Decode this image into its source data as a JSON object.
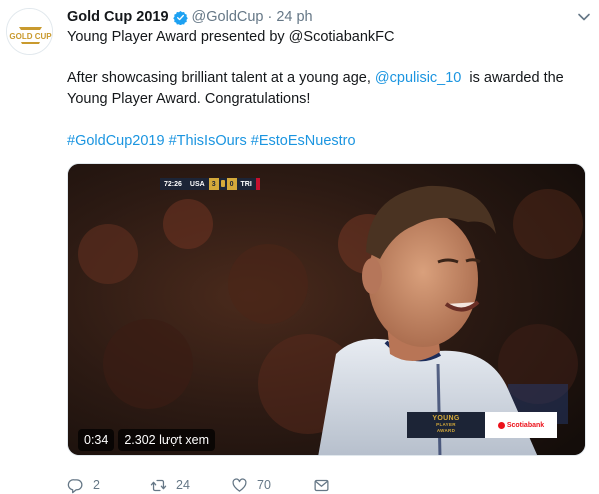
{
  "account": {
    "display_name": "Gold Cup 2019",
    "handle": "@GoldCup",
    "separator": "·",
    "time": "24 ph",
    "avatar_text": "GOLD CUP"
  },
  "tweet": {
    "line1": "Young Player Award presented by @ScotiabankFC",
    "line2_before": "After showcasing brilliant talent at a young age, ",
    "line2_mention": "@cpulisic_10",
    "line2_after": "  is awarded the",
    "line3": "Young Player Award. Congratulations!",
    "hashtags": [
      "#GoldCup2019",
      "#ThisIsOurs",
      "#EstoEsNuestro"
    ]
  },
  "video": {
    "scorebug": {
      "clock": "72:26",
      "home": "USA",
      "home_score": "3",
      "away_score": "0",
      "away": "TRI"
    },
    "award_lines": [
      "YOUNG",
      "PLAYER",
      "AWARD"
    ],
    "sponsor": "Scotiabank",
    "duration": "0:34",
    "views": "2.302 lượt xem"
  },
  "actions": {
    "reply_count": "2",
    "retweet_count": "24",
    "like_count": "70"
  },
  "colors": {
    "link": "#1b95e0",
    "text": "#14171a",
    "muted": "#657786",
    "verified": "#1da1f2"
  },
  "icons": [
    "verified-badge-icon",
    "caret-down-icon",
    "reply-icon",
    "retweet-icon",
    "like-icon",
    "direct-message-icon"
  ]
}
